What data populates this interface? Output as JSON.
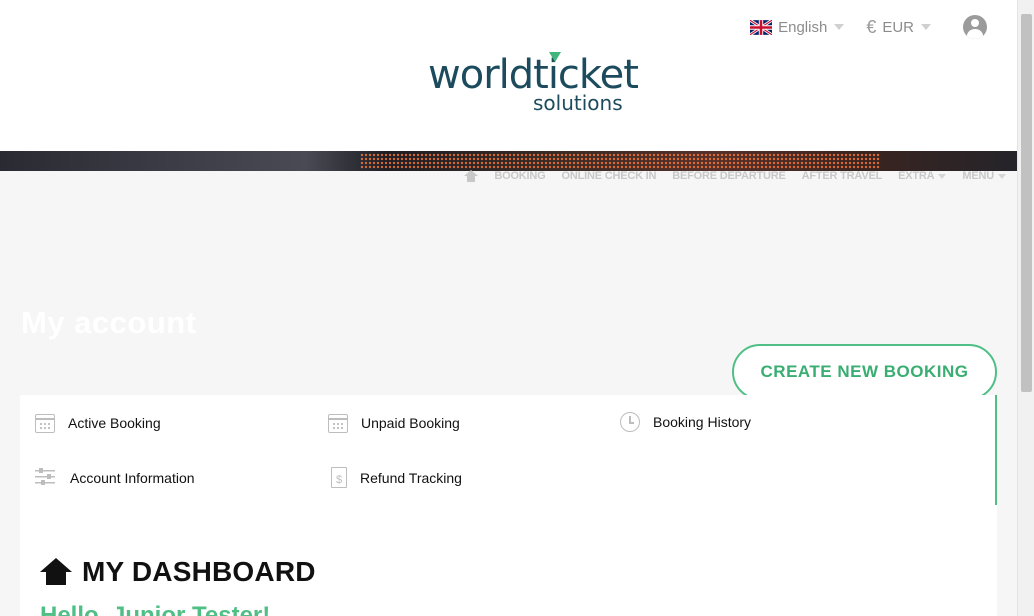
{
  "topbar": {
    "language": "English",
    "currency_symbol": "€",
    "currency": "EUR"
  },
  "logo": {
    "line1": "worldticket",
    "line2": "solutions"
  },
  "nav": {
    "items": [
      "BOOKING",
      "ONLINE CHECK IN",
      "BEFORE DEPARTURE",
      "AFTER TRAVEL",
      "EXTRA",
      "MENU"
    ]
  },
  "hero": {
    "title": "My account"
  },
  "actions": {
    "create_booking": "CREATE NEW BOOKING"
  },
  "account_menu": {
    "active_booking": "Active Booking",
    "unpaid_booking": "Unpaid Booking",
    "booking_history": "Booking History",
    "account_information": "Account Information",
    "refund_tracking": "Refund Tracking",
    "refund_symbol": "$"
  },
  "dashboard": {
    "title": "MY DASHBOARD",
    "greeting": "Hello, Junior Tester!"
  },
  "colors": {
    "accent": "#4fbf85",
    "brand": "#1c4b5e"
  }
}
